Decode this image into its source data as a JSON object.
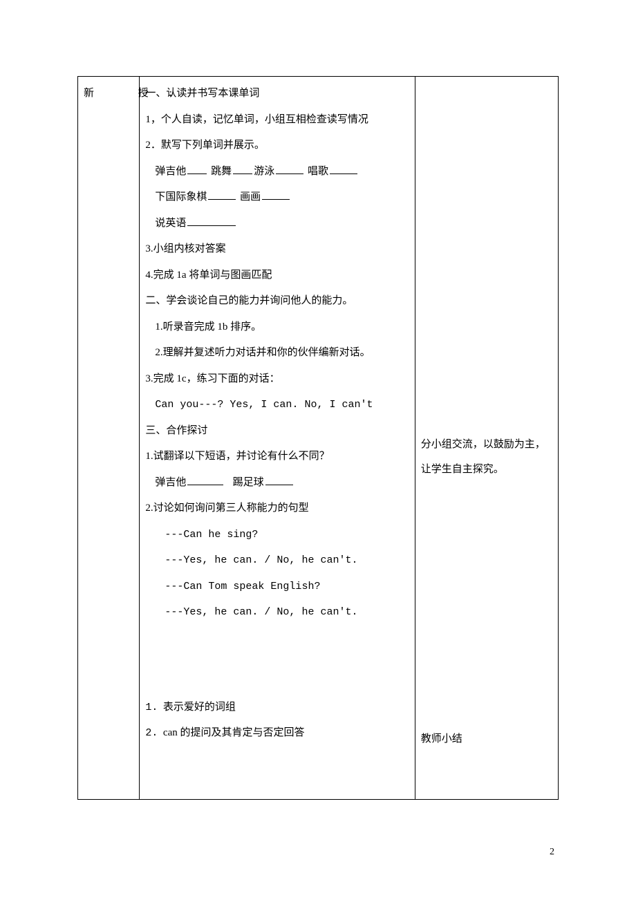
{
  "leftLabel": "新 授:",
  "mid": {
    "sec1_title": "一、认读并书写本课单词",
    "item1_1": "1，个人自读，记忆单词，小组互相检查读写情况",
    "item1_2": "2．默写下列单词并展示。",
    "vocab_line1_a": "弹吉他",
    "vocab_line1_b": "跳舞",
    "vocab_line1_c": "游泳",
    "vocab_line1_d": "唱歌",
    "vocab_line2_a": "下国际象棋",
    "vocab_line2_b": "画画",
    "vocab_line3_a": "说英语",
    "item1_3": "3.小组内核对答案",
    "item1_4": "4.完成 1a 将单词与图画匹配",
    "sec2_title": "二、学会谈论自己的能力并询问他人的能力。",
    "item2_1": "1.听录音完成 1b 排序。",
    "item2_2": "2.理解并复述听力对话并和你的伙伴编新对话。",
    "item2_3": "3.完成 1c，练习下面的对话：",
    "dialog1": "Can you---?  Yes, I can.   No, I can't",
    "sec3_title": "三、合作探讨",
    "item3_1": "1.试翻译以下短语，并讨论有什么不同？",
    "trans_a": "弹吉他",
    "trans_b": "踢足球",
    "item3_2": "2.讨论如何询问第三人称能力的句型",
    "dlg_he_q": "---Can he sing?",
    "dlg_he_a": "---Yes, he can. / No, he can't.",
    "dlg_tom_q": "---Can Tom speak English?",
    "dlg_tom_a": "---Yes, he can. / No, he can't.",
    "summary1_num": "1.",
    "summary1": "表示爱好的词组",
    "summary2_num": "2.",
    "summary2": "can 的提问及其肯定与否定回答"
  },
  "right": {
    "note1": "分小组交流，以鼓励为主，让学生自主探究。",
    "note2": "教师小结"
  },
  "pageNumber": "2"
}
